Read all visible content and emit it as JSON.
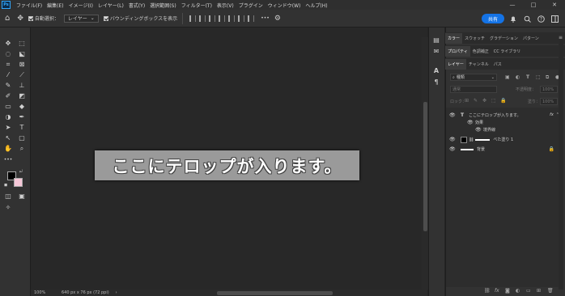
{
  "app": {
    "logo": "Ps"
  },
  "menu": [
    "ファイル(F)",
    "編集(E)",
    "イメージ(I)",
    "レイヤー(L)",
    "書式(Y)",
    "選択範囲(S)",
    "フィルター(T)",
    "表示(V)",
    "プラグイン",
    "ウィンドウ(W)",
    "ヘルプ(H)"
  ],
  "window_controls": {
    "minimize": "—",
    "maximize": "□",
    "close": "✕"
  },
  "options": {
    "auto_select_label": "自動選択：",
    "auto_select_value": "レイヤー",
    "bounding_box_label": "バウンディングボックスを表示",
    "more": "•••",
    "share": "共有"
  },
  "icons": {
    "home": "⌂",
    "move": "✥",
    "gear": "⚙",
    "bell": "🔔",
    "search": "⌕",
    "help": "?",
    "account": "◯"
  },
  "canvas": {
    "text": "ここにテロップが入ります。"
  },
  "status": {
    "zoom": "100%",
    "doc_size": "640 px x 76 px (72 ppi)"
  },
  "panels": {
    "top_tabs": [
      "カラー",
      "スウォッチ",
      "グラデーション",
      "パターン"
    ],
    "mid_tabs": [
      "プロパティ",
      "色調補正",
      "CC ライブラリ"
    ],
    "layer_tabs": [
      "レイヤー",
      "チャンネル",
      "パス"
    ],
    "kind_filter": "種類",
    "blend_mode": "通常",
    "opacity_label": "不透明度：",
    "opacity_value": "100%",
    "lock_label": "ロック：",
    "fill_label": "塗り：",
    "fill_value": "100%",
    "layers": [
      {
        "name": "ここにテロップが入ります。",
        "type": "T",
        "fx": "fx"
      },
      {
        "name": "効果"
      },
      {
        "name": "境界線"
      },
      {
        "name": "べた塗り 1"
      },
      {
        "name": "背景"
      }
    ]
  },
  "colors": {
    "accent": "#1473e6",
    "fg_swatch": "#000000",
    "bg_swatch": "#f6c8d8"
  }
}
